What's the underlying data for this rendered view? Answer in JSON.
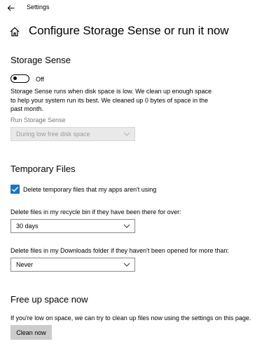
{
  "window": {
    "title": "Settings",
    "back_icon": "back-arrow-icon"
  },
  "page": {
    "title": "Configure Storage Sense or run it now",
    "home_icon": "home-icon"
  },
  "storage_sense": {
    "header": "Storage Sense",
    "toggle_state": "Off",
    "description_lines": [
      "Storage Sense runs when disk space is low. We clean up enough space",
      "to help your system run its best. We cleaned up 0 bytes of space in the",
      "past month."
    ],
    "run_label": "Run Storage Sense",
    "run_value": "During low free disk space"
  },
  "temporary_files": {
    "header": "Temporary Files",
    "checkbox_label": "Delete temporary files that my apps aren't using",
    "checkbox_checked": true,
    "recycle_label": "Delete files in my recycle bin if they have been there for over:",
    "recycle_value": "30 days",
    "downloads_label": "Delete files in my Downloads folder if they haven't been opened for more than:",
    "downloads_value": "Never"
  },
  "free_up": {
    "header": "Free up space now",
    "description": "If you're low on space, we can try to clean up files now using the settings on this page.",
    "button_label": "Clean now"
  },
  "colors": {
    "accent": "#1a73c8",
    "button_bg": "#cccccc",
    "disabled_bg": "#e9e9e9",
    "muted_text": "#777777"
  }
}
